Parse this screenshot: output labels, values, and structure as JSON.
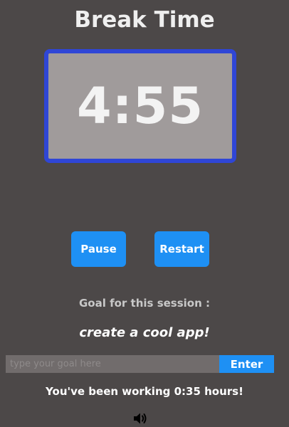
{
  "title": "Break Time",
  "timer": {
    "display": "4:55"
  },
  "buttons": {
    "pause_label": "Pause",
    "restart_label": "Restart"
  },
  "goal": {
    "label": "Goal for this session :",
    "current": "create a cool app!",
    "input_placeholder": "type your goal here",
    "input_value": "",
    "enter_label": "Enter"
  },
  "status": {
    "working_text": "You've been working 0:35 hours!"
  },
  "icons": {
    "sound": "speaker-volume-icon"
  },
  "colors": {
    "background": "#4c4848",
    "timer_border": "#2f46d6",
    "timer_fill": "#a09b9b",
    "button": "#1e90f4"
  }
}
